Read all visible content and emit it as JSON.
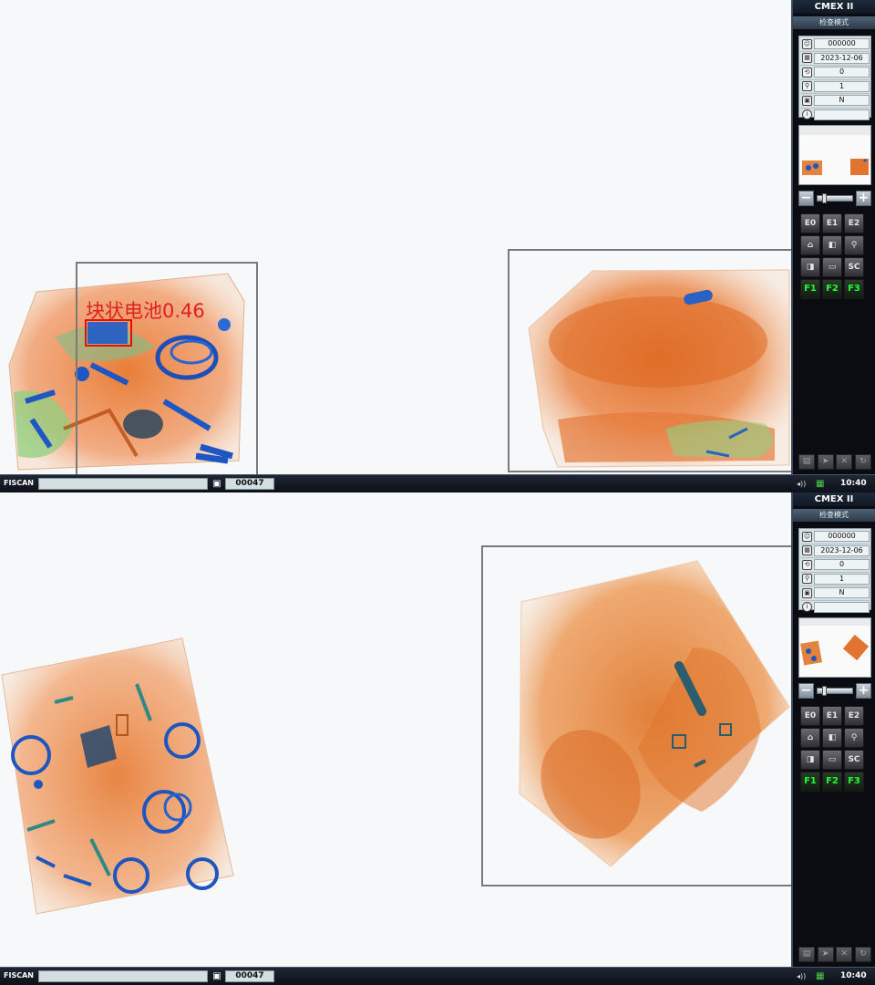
{
  "app": {
    "name": "CMEX II",
    "mode": "检查模式",
    "brand": "FISCAN"
  },
  "colors": {
    "detection": "#e01010",
    "selection": "#7a7a7a",
    "function_keys": "#1cff2c"
  },
  "panes": [
    {
      "id": "top",
      "detection": {
        "label": "块状电池0.46",
        "class": "块状电池",
        "score": 0.46
      },
      "info": {
        "operator_id": "000000",
        "date": "2023-12-06",
        "field3": "0",
        "zoom_level": "1",
        "field5": "N",
        "field6": ""
      },
      "status": {
        "bag_count": "00047",
        "time": "10:40"
      }
    },
    {
      "id": "bottom",
      "info": {
        "operator_id": "000000",
        "date": "2023-12-06",
        "field3": "0",
        "zoom_level": "1",
        "field5": "N",
        "field6": ""
      },
      "status": {
        "bag_count": "00047",
        "time": "10:40"
      }
    }
  ],
  "info_icons": [
    "operator-icon",
    "calendar-icon",
    "counter-icon",
    "magnifier-icon",
    "user-badge-icon",
    "info-icon"
  ],
  "buttons": [
    [
      "E0",
      "E1",
      "E2"
    ],
    [
      "home-icon",
      "contrast-icon",
      "zoom-icon"
    ],
    [
      "invert-icon",
      "film-icon",
      "SC"
    ],
    [
      "F1",
      "F2",
      "F3"
    ]
  ],
  "button_labels": {
    "e0": "E0",
    "e1": "E1",
    "e2": "E2",
    "sc": "SC",
    "f1": "F1",
    "f2": "F2",
    "f3": "F3"
  },
  "bottom_icons": [
    "save-icon",
    "send-icon",
    "tools-icon",
    "refresh-icon"
  ],
  "zoom": {
    "minus": "−",
    "plus": "+"
  }
}
